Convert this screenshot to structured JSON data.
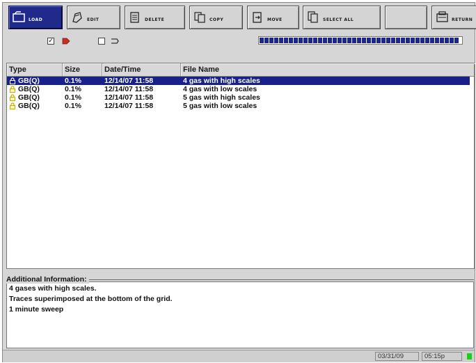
{
  "toolbar": {
    "buttons": [
      {
        "label": "LOAD",
        "icon": "load-icon",
        "active": true
      },
      {
        "label": "EDIT",
        "icon": "edit-icon"
      },
      {
        "label": "DELETE",
        "icon": "delete-icon"
      },
      {
        "label": "COPY",
        "icon": "copy-icon"
      },
      {
        "label": "MOVE",
        "icon": "move-icon"
      },
      {
        "label": "SELECT ALL",
        "icon": "select-all-icon"
      },
      {
        "label": "",
        "icon": "blank"
      },
      {
        "label": "RETURN",
        "icon": "return-icon"
      }
    ]
  },
  "options": {
    "checkbox1_checked": true,
    "checkbox2_checked": false,
    "progress_fraction": 0.99
  },
  "file_list": {
    "columns": [
      "Type",
      "Size",
      "Date/Time",
      "File Name"
    ],
    "rows": [
      {
        "type": "GB(Q)",
        "size": "0.1%",
        "datetime": "12/14/07 11:58",
        "name": "4 gas with high scales",
        "selected": true
      },
      {
        "type": "GB(Q)",
        "size": "0.1%",
        "datetime": "12/14/07 11:58",
        "name": "4 gas with low scales",
        "selected": false
      },
      {
        "type": "GB(Q)",
        "size": "0.1%",
        "datetime": "12/14/07 11:58",
        "name": "5 gas with high scales",
        "selected": false
      },
      {
        "type": "GB(Q)",
        "size": "0.1%",
        "datetime": "12/14/07 11:58",
        "name": "5 gas with low scales",
        "selected": false
      }
    ]
  },
  "additional_info": {
    "label": "Additional Information:",
    "lines": [
      "4 gases with high scales.",
      "Traces superimposed at the bottom of the grid.",
      "1 minute sweep"
    ]
  },
  "status": {
    "date": "03/31/09",
    "time": "05:15p"
  },
  "colors": {
    "selection": "#18208a",
    "progress": "#1c2590",
    "led": "#19d119"
  }
}
